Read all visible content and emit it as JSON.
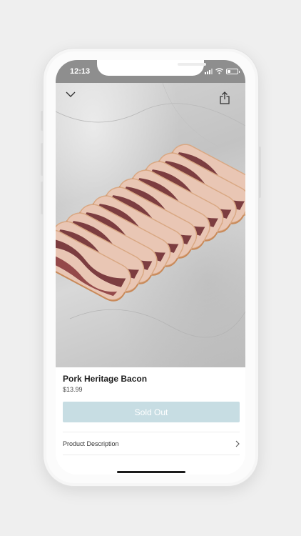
{
  "status_bar": {
    "time": "12:13",
    "battery_level": 0.3,
    "icons": [
      "signal-icon",
      "wifi-icon",
      "battery-icon"
    ]
  },
  "hero": {
    "image_subject": "sliced bacon on marble",
    "back_icon": "chevron-down-icon",
    "share_icon": "share-icon"
  },
  "product": {
    "name": "Pork Heritage Bacon",
    "price": "$13.99",
    "cta_label": "Sold Out",
    "cta_color": "#c7dde3",
    "description_label": "Product Description",
    "description_icon": "chevron-right-icon"
  }
}
